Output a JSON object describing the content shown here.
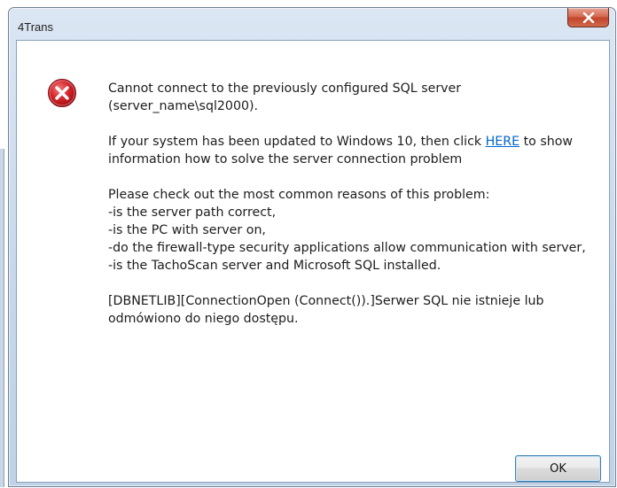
{
  "window": {
    "title": "4Trans"
  },
  "dialog": {
    "icon": "error-icon",
    "line1": "Cannot connect to the previously configured SQL server",
    "line2": "(server_name\\sql2000).",
    "win10_prefix": "If your system has been updated to Windows 10, then click ",
    "win10_link": "HERE",
    "win10_suffix": " to show information how to solve the server connection problem",
    "reasons_intro": "Please check out the most common reasons of this problem:",
    "reasons": [
      "-is the server path correct,",
      "-is the PC with server on,",
      "-do the firewall-type security applications allow communication with server,",
      "-is the TachoScan server and Microsoft SQL installed."
    ],
    "error_detail": "[DBNETLIB][ConnectionOpen (Connect()).]Serwer SQL nie istnieje lub odmówiono do niego dostępu."
  },
  "buttons": {
    "ok": "OK"
  },
  "colors": {
    "link": "#0066cc",
    "error_red": "#c8181e",
    "close_red": "#c94a30"
  }
}
